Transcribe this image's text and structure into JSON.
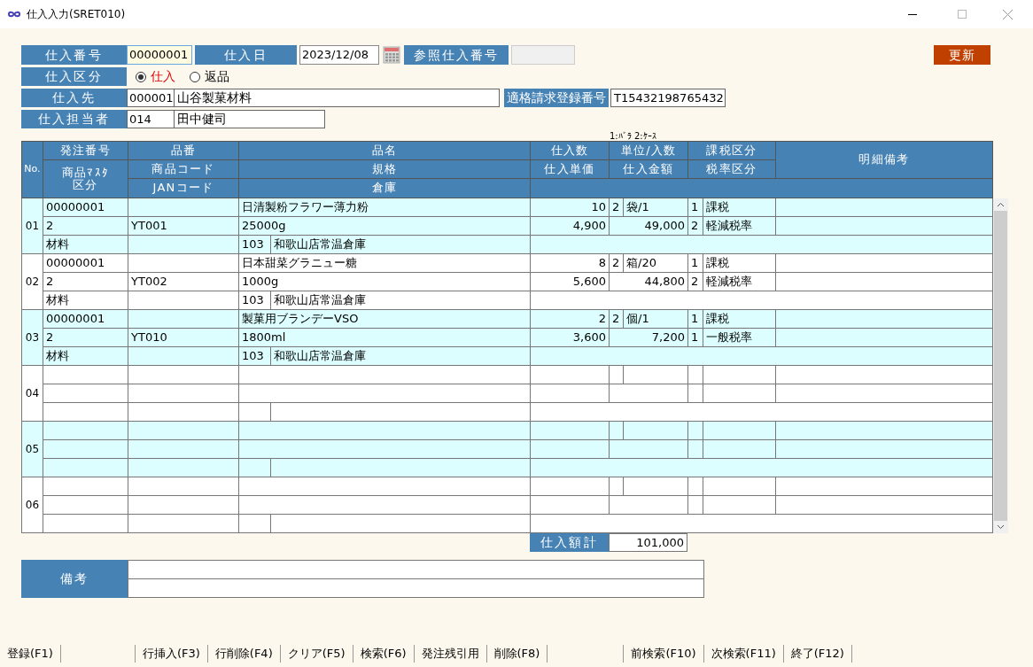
{
  "window": {
    "title": "仕入入力(SRET010)"
  },
  "header": {
    "purchase_no_label": "仕入番号",
    "purchase_no": "00000001",
    "date_label": "仕入日",
    "date": "2023/12/08",
    "ref_label": "参照仕入番号",
    "update_button": "更新",
    "type_label": "仕入区分",
    "types": [
      {
        "label": "仕入",
        "selected": true
      },
      {
        "label": "返品",
        "selected": false
      }
    ],
    "supplier_label": "仕入先",
    "supplier_code": "000001",
    "supplier_name": "山谷製菓材料",
    "invoice_label": "適格請求登録番号",
    "invoice_no": "T15432198765432",
    "staff_label": "仕入担当者",
    "staff_code": "014",
    "staff_name": "田中健司"
  },
  "unit_hint": "1:ﾊﾞﾗ 2:ｹｰｽ",
  "table": {
    "columns": {
      "no": "No.",
      "order_no": "発注番号",
      "master_kbn": [
        "商品ﾏｽﾀ",
        "区分"
      ],
      "item_no": "品番",
      "product_code": "商品コード",
      "jan": "JANコード",
      "name": "品名",
      "spec": "規格",
      "warehouse": "倉庫",
      "qty": "仕入数",
      "price": "仕入単価",
      "unit": "単位/入数",
      "amount": "仕入金額",
      "tax": "課税区分",
      "rate": "税率区分",
      "remark": "明細備考"
    },
    "rows": [
      {
        "no": "01",
        "order_no": "00000001",
        "name": "日清製粉フラワー薄力粉",
        "qty": "10",
        "unit_code": "2",
        "unit": "袋/1",
        "tax_code": "1",
        "tax": "課税",
        "master_kbn": "2",
        "product_code": "YT001",
        "spec": "25000g",
        "price": "4,900",
        "amount": "49,000",
        "rate_code": "2",
        "rate": "軽減税率",
        "category": "材料",
        "warehouse_code": "103",
        "warehouse": "和歌山店常温倉庫"
      },
      {
        "no": "02",
        "order_no": "00000001",
        "name": "日本甜菜グラニュー糖",
        "qty": "8",
        "unit_code": "2",
        "unit": "箱/20",
        "tax_code": "1",
        "tax": "課税",
        "master_kbn": "2",
        "product_code": "YT002",
        "spec": "1000g",
        "price": "5,600",
        "amount": "44,800",
        "rate_code": "2",
        "rate": "軽減税率",
        "category": "材料",
        "warehouse_code": "103",
        "warehouse": "和歌山店常温倉庫"
      },
      {
        "no": "03",
        "order_no": "00000001",
        "name": "製菓用ブランデーVSO",
        "qty": "2",
        "unit_code": "2",
        "unit": "個/1",
        "tax_code": "1",
        "tax": "課税",
        "master_kbn": "2",
        "product_code": "YT010",
        "spec": "1800ml",
        "price": "3,600",
        "amount": "7,200",
        "rate_code": "1",
        "rate": "一般税率",
        "category": "材料",
        "warehouse_code": "103",
        "warehouse": "和歌山店常温倉庫"
      },
      {
        "no": "04"
      },
      {
        "no": "05"
      },
      {
        "no": "06"
      }
    ]
  },
  "total": {
    "label": "仕入額計",
    "value": "101,000"
  },
  "remarks": {
    "label": "備考"
  },
  "function_keys": [
    {
      "kind": "key",
      "label": "登録(F1)"
    },
    {
      "kind": "blank"
    },
    {
      "kind": "key",
      "label": "行挿入(F3)"
    },
    {
      "kind": "key",
      "label": "行削除(F4)"
    },
    {
      "kind": "key",
      "label": "クリア(F5)"
    },
    {
      "kind": "key",
      "label": "検索(F6)"
    },
    {
      "kind": "key",
      "label": "発注残引用"
    },
    {
      "kind": "key",
      "label": "削除(F8)"
    },
    {
      "kind": "blank"
    },
    {
      "kind": "key",
      "label": "前検索(F10)"
    },
    {
      "kind": "key",
      "label": "次検索(F11)"
    },
    {
      "kind": "key",
      "label": "終了(F12)"
    }
  ]
}
